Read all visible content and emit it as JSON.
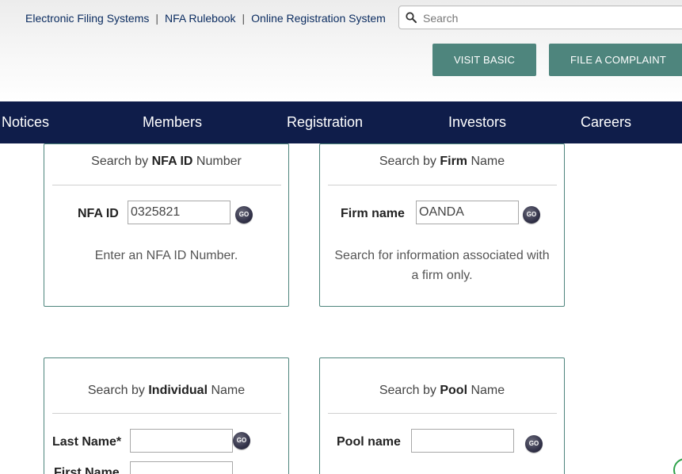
{
  "header": {
    "top_links": [
      "Electronic Filing Systems",
      "NFA Rulebook",
      "Online Registration System"
    ],
    "separator": "|",
    "search": {
      "placeholder": "Search",
      "value": ""
    },
    "buttons": {
      "visit_basic": "VISIT BASIC",
      "file_complaint": "FILE A COMPLAINT"
    }
  },
  "nav": {
    "items": [
      "Notices",
      "Members",
      "Registration",
      "Investors",
      "Careers"
    ]
  },
  "cards": {
    "nfa_id": {
      "title_pre": "Search by ",
      "title_bold": "NFA ID",
      "title_post": " Number",
      "label": "NFA ID",
      "value": "0325821",
      "go": "GO",
      "desc": "Enter an NFA ID Number."
    },
    "firm": {
      "title_pre": "Search by ",
      "title_bold": "Firm",
      "title_post": " Name",
      "label": "Firm name",
      "value": "OANDA",
      "go": "GO",
      "desc": "Search for information associated with a firm only."
    },
    "individual": {
      "title_pre": "Search by ",
      "title_bold": "Individual",
      "title_post": " Name",
      "last_label": "Last Name*",
      "last_value": "",
      "first_label": "First Name",
      "first_value": "",
      "go": "GO"
    },
    "pool": {
      "title_pre": "Search by ",
      "title_bold": "Pool",
      "title_post": " Name",
      "label": "Pool name",
      "value": "",
      "go": "GO"
    }
  },
  "colors": {
    "nav_bg": "#0f1d4a",
    "accent": "#4e857d",
    "link": "#0b2c60"
  }
}
